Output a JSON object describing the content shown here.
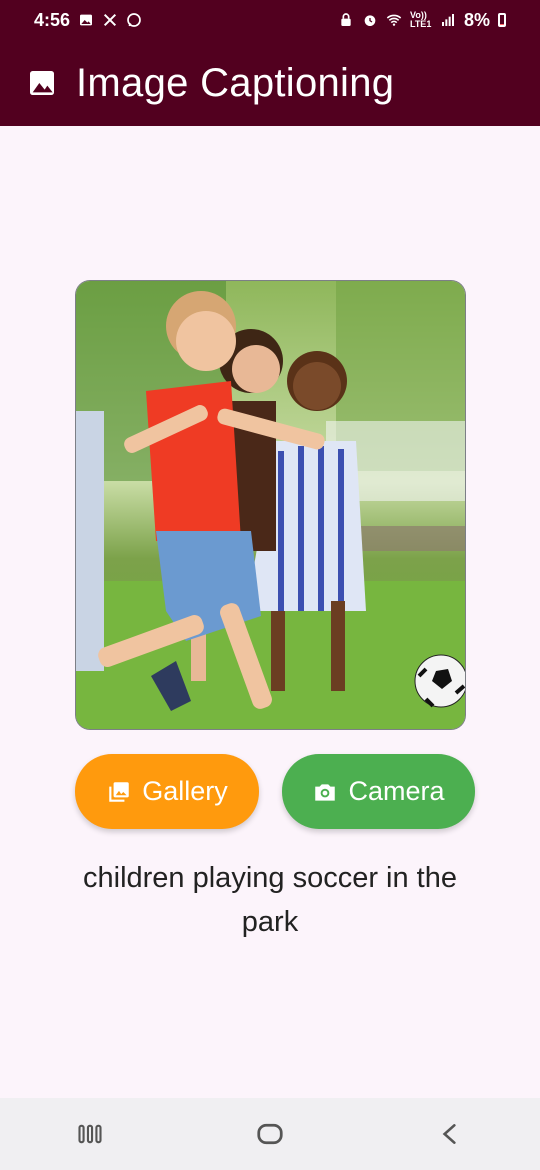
{
  "status_bar": {
    "time": "4:56",
    "left_icons": [
      "image-icon",
      "x-icon",
      "whatsapp-icon"
    ],
    "right_icons": [
      "lock-icon",
      "alarm-icon",
      "wifi-icon",
      "lte-icon",
      "signal-icon"
    ],
    "lte_label": "Vo)) LTE1",
    "battery_text": "8%",
    "battery_level": 0.08
  },
  "app_bar": {
    "title": "Image Captioning",
    "icon": "image-icon",
    "background": "#52001f"
  },
  "main": {
    "image_alt": "children playing soccer in the park",
    "buttons": {
      "gallery_label": "Gallery",
      "camera_label": "Camera"
    },
    "caption": "children playing soccer in the park"
  },
  "colors": {
    "gallery": "#ff9a0d",
    "camera": "#4caf50",
    "page_bg": "#fcf4fb"
  },
  "nav_bar": {
    "items": [
      "recent-apps-icon",
      "home-icon",
      "back-icon"
    ]
  }
}
